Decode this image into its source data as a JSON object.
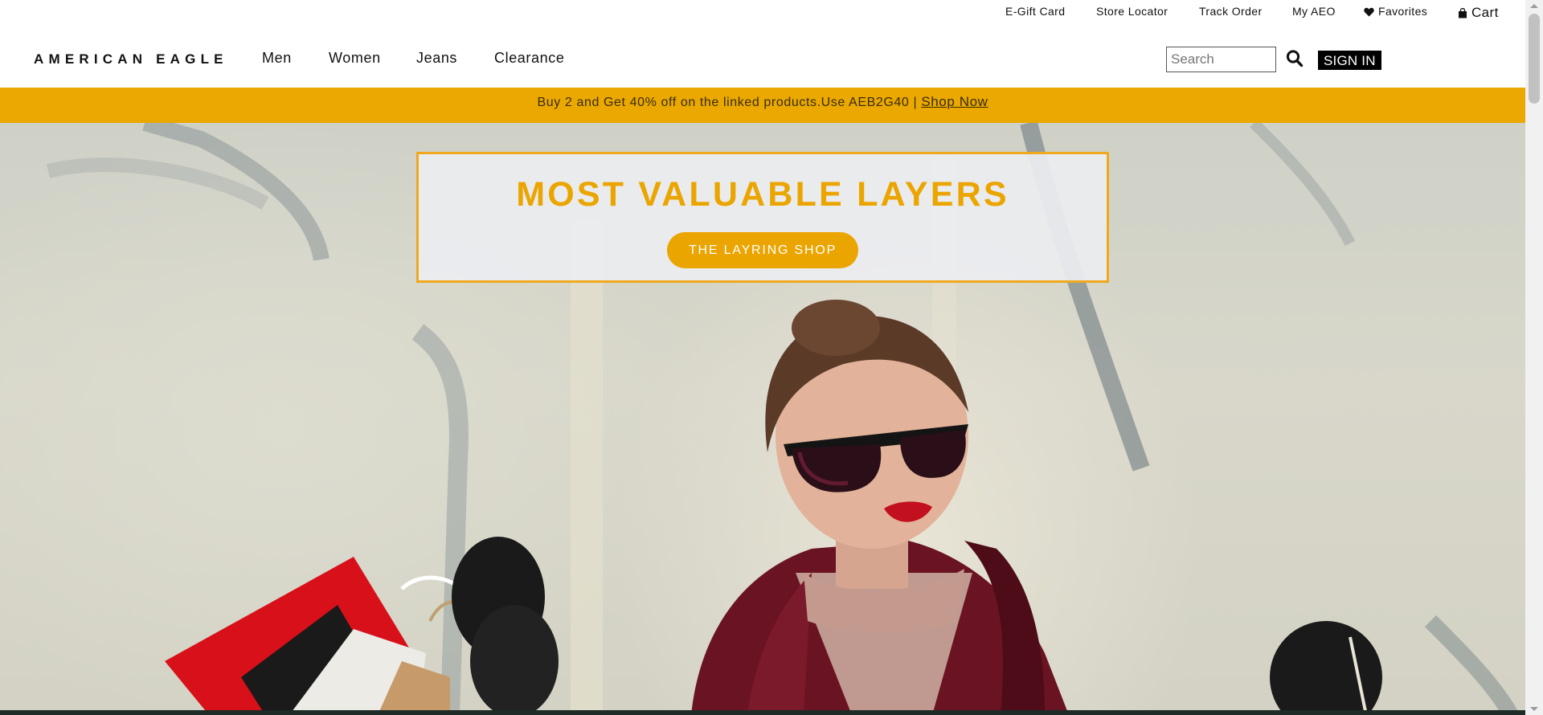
{
  "utility_nav": {
    "egift": "E-Gift Card",
    "store_locator": "Store Locator",
    "track_order": "Track Order",
    "my_aeo": "My AEO",
    "favorites": "Favorites",
    "cart": "Cart"
  },
  "header": {
    "logo": "AMERICAN EAGLE",
    "nav": [
      "Men",
      "Women",
      "Jeans",
      "Clearance"
    ],
    "search_placeholder": "Search",
    "search_value": "",
    "sign_in": "SIGN IN"
  },
  "promo": {
    "text": "Buy 2 and Get 40% off on the linked products.Use AEB2G40 |",
    "link": "Shop Now",
    "background": "#eaa800"
  },
  "hero": {
    "title": "MOST VALUABLE LAYERS",
    "cta": "THE LAYRING SHOP",
    "accent": "#eba500"
  },
  "icons": [
    "heart-icon",
    "shopping-bag-icon",
    "search-icon"
  ]
}
